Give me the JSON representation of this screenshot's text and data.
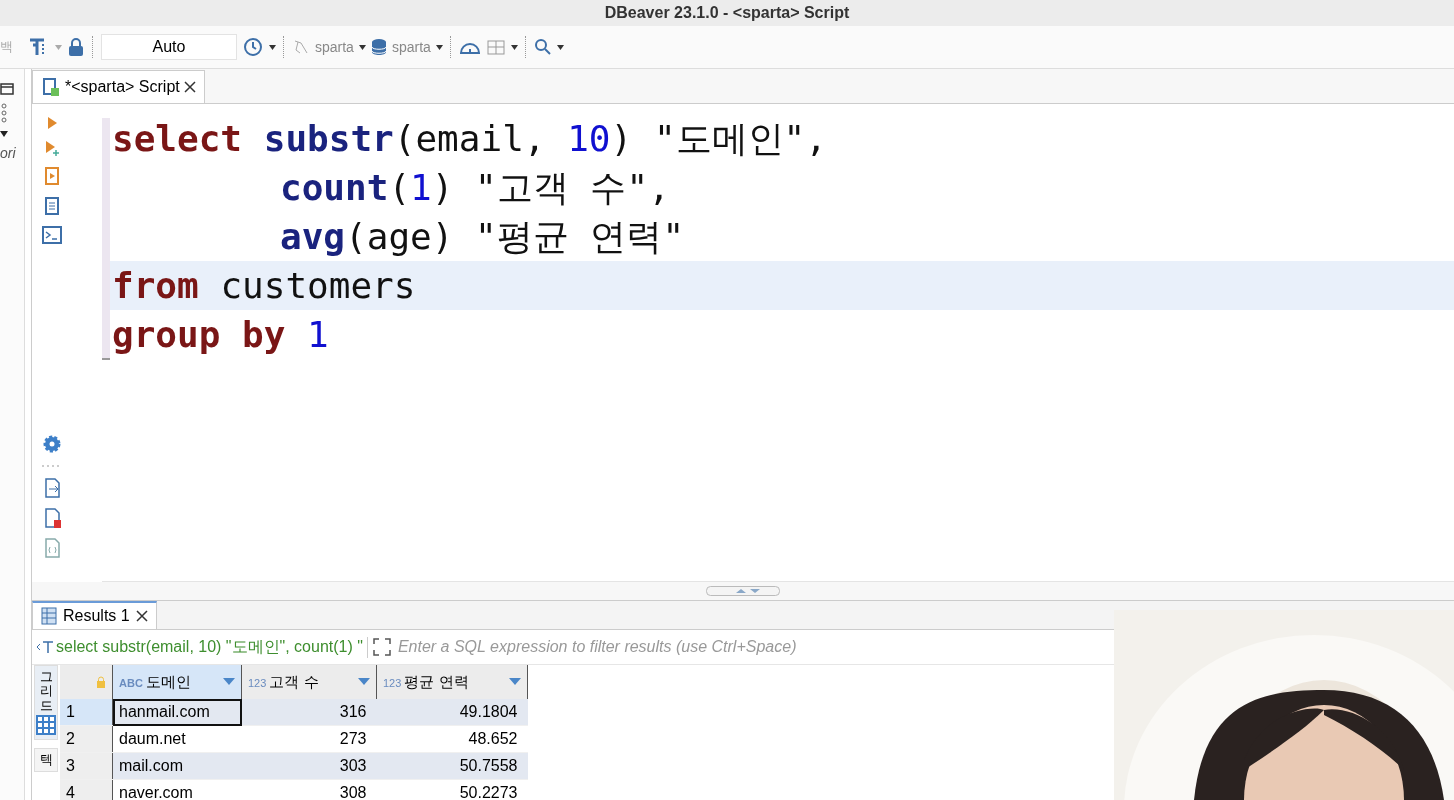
{
  "window": {
    "title": "DBeaver 23.1.0 - <sparta> Script"
  },
  "toolbar": {
    "left_clip": "백",
    "transaction_mode": "Auto",
    "connection": "sparta",
    "database": "sparta"
  },
  "left_panel": {
    "clip_text": "ori"
  },
  "editor_tab": {
    "label": "*<sparta> Script",
    "selected": true
  },
  "code_lines": [
    {
      "current": false,
      "indent": false,
      "tokens": [
        {
          "kind": "keyword",
          "text": "select "
        },
        {
          "kind": "func",
          "text": "substr"
        },
        {
          "kind": "plain",
          "text": "(email, "
        },
        {
          "kind": "number",
          "text": "10"
        },
        {
          "kind": "plain",
          "text": ") "
        },
        {
          "kind": "string",
          "text": "\"도메인\""
        },
        {
          "kind": "plain",
          "text": ","
        }
      ]
    },
    {
      "current": false,
      "indent": true,
      "tokens": [
        {
          "kind": "func",
          "text": "count"
        },
        {
          "kind": "plain",
          "text": "("
        },
        {
          "kind": "number",
          "text": "1"
        },
        {
          "kind": "plain",
          "text": ") "
        },
        {
          "kind": "string",
          "text": "\"고객 수\""
        },
        {
          "kind": "plain",
          "text": ","
        }
      ]
    },
    {
      "current": false,
      "indent": true,
      "tokens": [
        {
          "kind": "func",
          "text": "avg"
        },
        {
          "kind": "plain",
          "text": "(age) "
        },
        {
          "kind": "string",
          "text": "\"평균 연력\""
        }
      ]
    },
    {
      "current": true,
      "indent": false,
      "tokens": [
        {
          "kind": "keyword",
          "text": "from "
        },
        {
          "kind": "plain",
          "text": "customers"
        }
      ]
    },
    {
      "current": false,
      "indent": false,
      "tokens": [
        {
          "kind": "keyword",
          "text": "group by "
        },
        {
          "kind": "number",
          "text": "1"
        }
      ]
    }
  ],
  "results_tab": {
    "label": "Results 1",
    "selected": true
  },
  "filter": {
    "query": "select substr(email, 10) \"도메인\", count(1) \"",
    "placeholder": "Enter a SQL expression to filter results (use Ctrl+Space)"
  },
  "side_tabs": [
    {
      "label": "그리드",
      "selected": true
    },
    {
      "label": "텍",
      "selected": false
    }
  ],
  "table": {
    "columns": [
      {
        "type": "ABC",
        "name": "도메인",
        "selected": true
      },
      {
        "type": "123",
        "name": "고객 수",
        "selected": false
      },
      {
        "type": "123",
        "name": "평균 연력",
        "selected": false
      }
    ],
    "rows": [
      {
        "index": "1",
        "selected": true,
        "cells": [
          "hanmail.com",
          "316",
          "49.1804"
        ]
      },
      {
        "index": "2",
        "selected": false,
        "cells": [
          "daum.net",
          "273",
          "48.652"
        ]
      },
      {
        "index": "3",
        "selected": false,
        "cells": [
          "mail.com",
          "303",
          "50.7558"
        ]
      },
      {
        "index": "4",
        "selected": false,
        "cells": [
          "naver.com",
          "308",
          "50.2273"
        ]
      }
    ]
  }
}
